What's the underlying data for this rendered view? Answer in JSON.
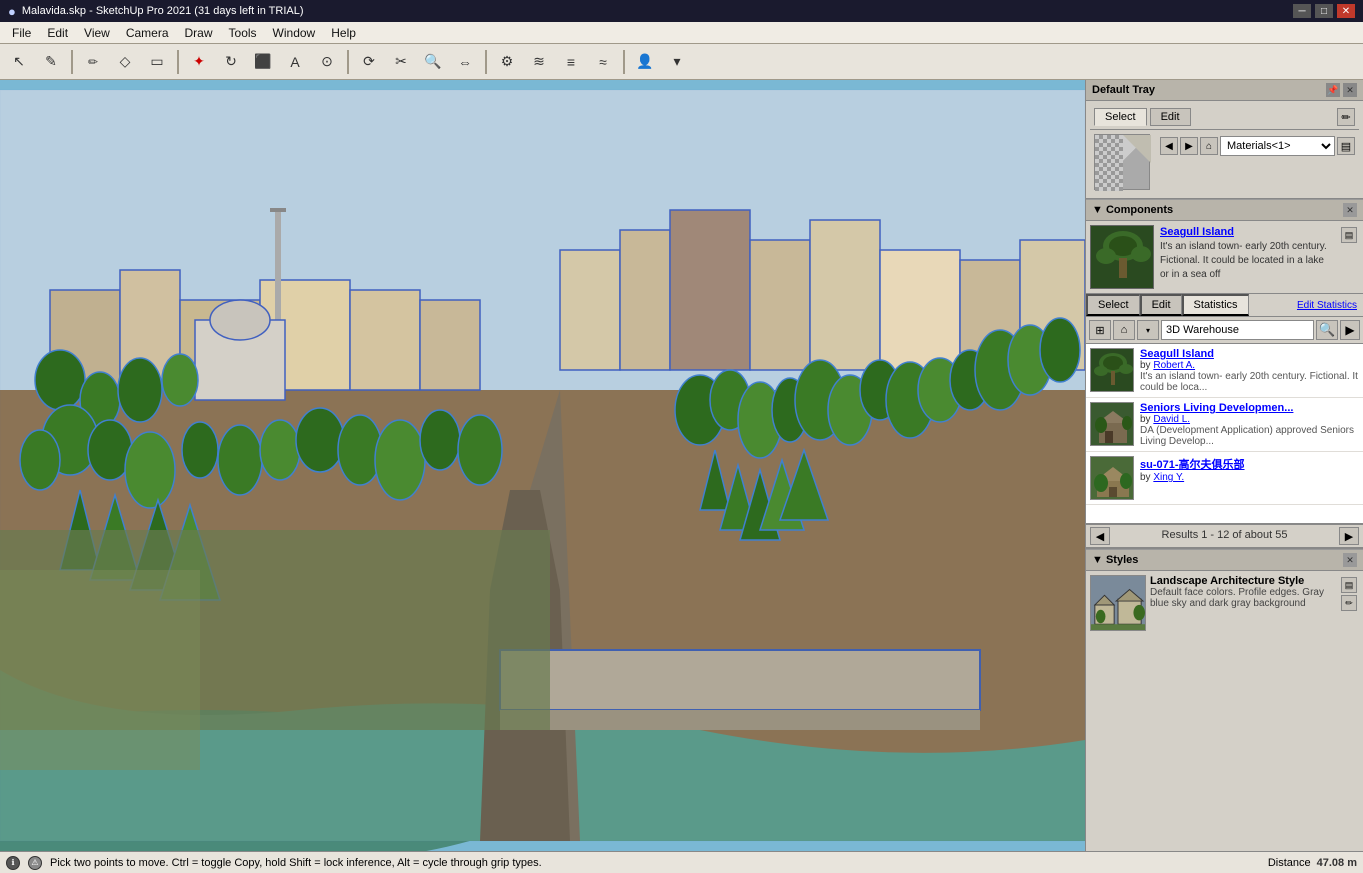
{
  "titlebar": {
    "icon": "●",
    "title": "Malavida.skp - SketchUp Pro 2021 (31 days left in TRIAL)",
    "minimize": "─",
    "maximize": "□",
    "close": "✕"
  },
  "menubar": {
    "items": [
      "File",
      "Edit",
      "View",
      "Camera",
      "Draw",
      "Tools",
      "Window",
      "Help"
    ]
  },
  "toolbar": {
    "tools": [
      "↖",
      "✎",
      "✏",
      "◇",
      "▭",
      "✦",
      "↻",
      "⬛",
      "A",
      "⊙",
      "⟳",
      "✂",
      "🔍",
      "⇔",
      "⚙",
      "≋",
      "≡",
      "≈",
      "👤",
      "▾"
    ]
  },
  "default_tray": {
    "title": "Default Tray"
  },
  "materials": {
    "select_tab": "Select",
    "edit_tab": "Edit",
    "dropdown_value": "Materials<1>",
    "preview_type": "checkerboard"
  },
  "components": {
    "section_title": "Components",
    "preview": {
      "name": "Seagull Island",
      "description": "It's an island town- early 20th century. Fictional. It could be located in a lake or in a sea off"
    },
    "tabs": {
      "select": "Select",
      "edit": "Edit",
      "statistics": "Statistics",
      "edit_stats": "Edit Statistics"
    },
    "search": {
      "source": "3D Warehouse",
      "placeholder": "3D Warehouse"
    },
    "results": [
      {
        "title": "Seagull Island",
        "author": "Robert A.",
        "description": "It's an island town- early 20th century. Fictional. It could be loca..."
      },
      {
        "title": "Seniors Living Developmen...",
        "author": "David L.",
        "description": "DA (Development Application) approved Seniors Living Develop..."
      },
      {
        "title": "su-071-高尔夫俱乐部",
        "author": "Xing Y.",
        "description": ""
      }
    ],
    "results_count": "Results 1 - 12 of about 55"
  },
  "styles": {
    "section_title": "Styles",
    "name": "Landscape Architecture Style",
    "description": "Default face colors. Profile edges. Gray blue sky and dark gray background"
  },
  "statusbar": {
    "hint": "Pick two points to move.  Ctrl = toggle Copy, hold Shift = lock inference, Alt = cycle through grip types.",
    "distance_label": "Distance",
    "distance_value": "47.08 m"
  }
}
